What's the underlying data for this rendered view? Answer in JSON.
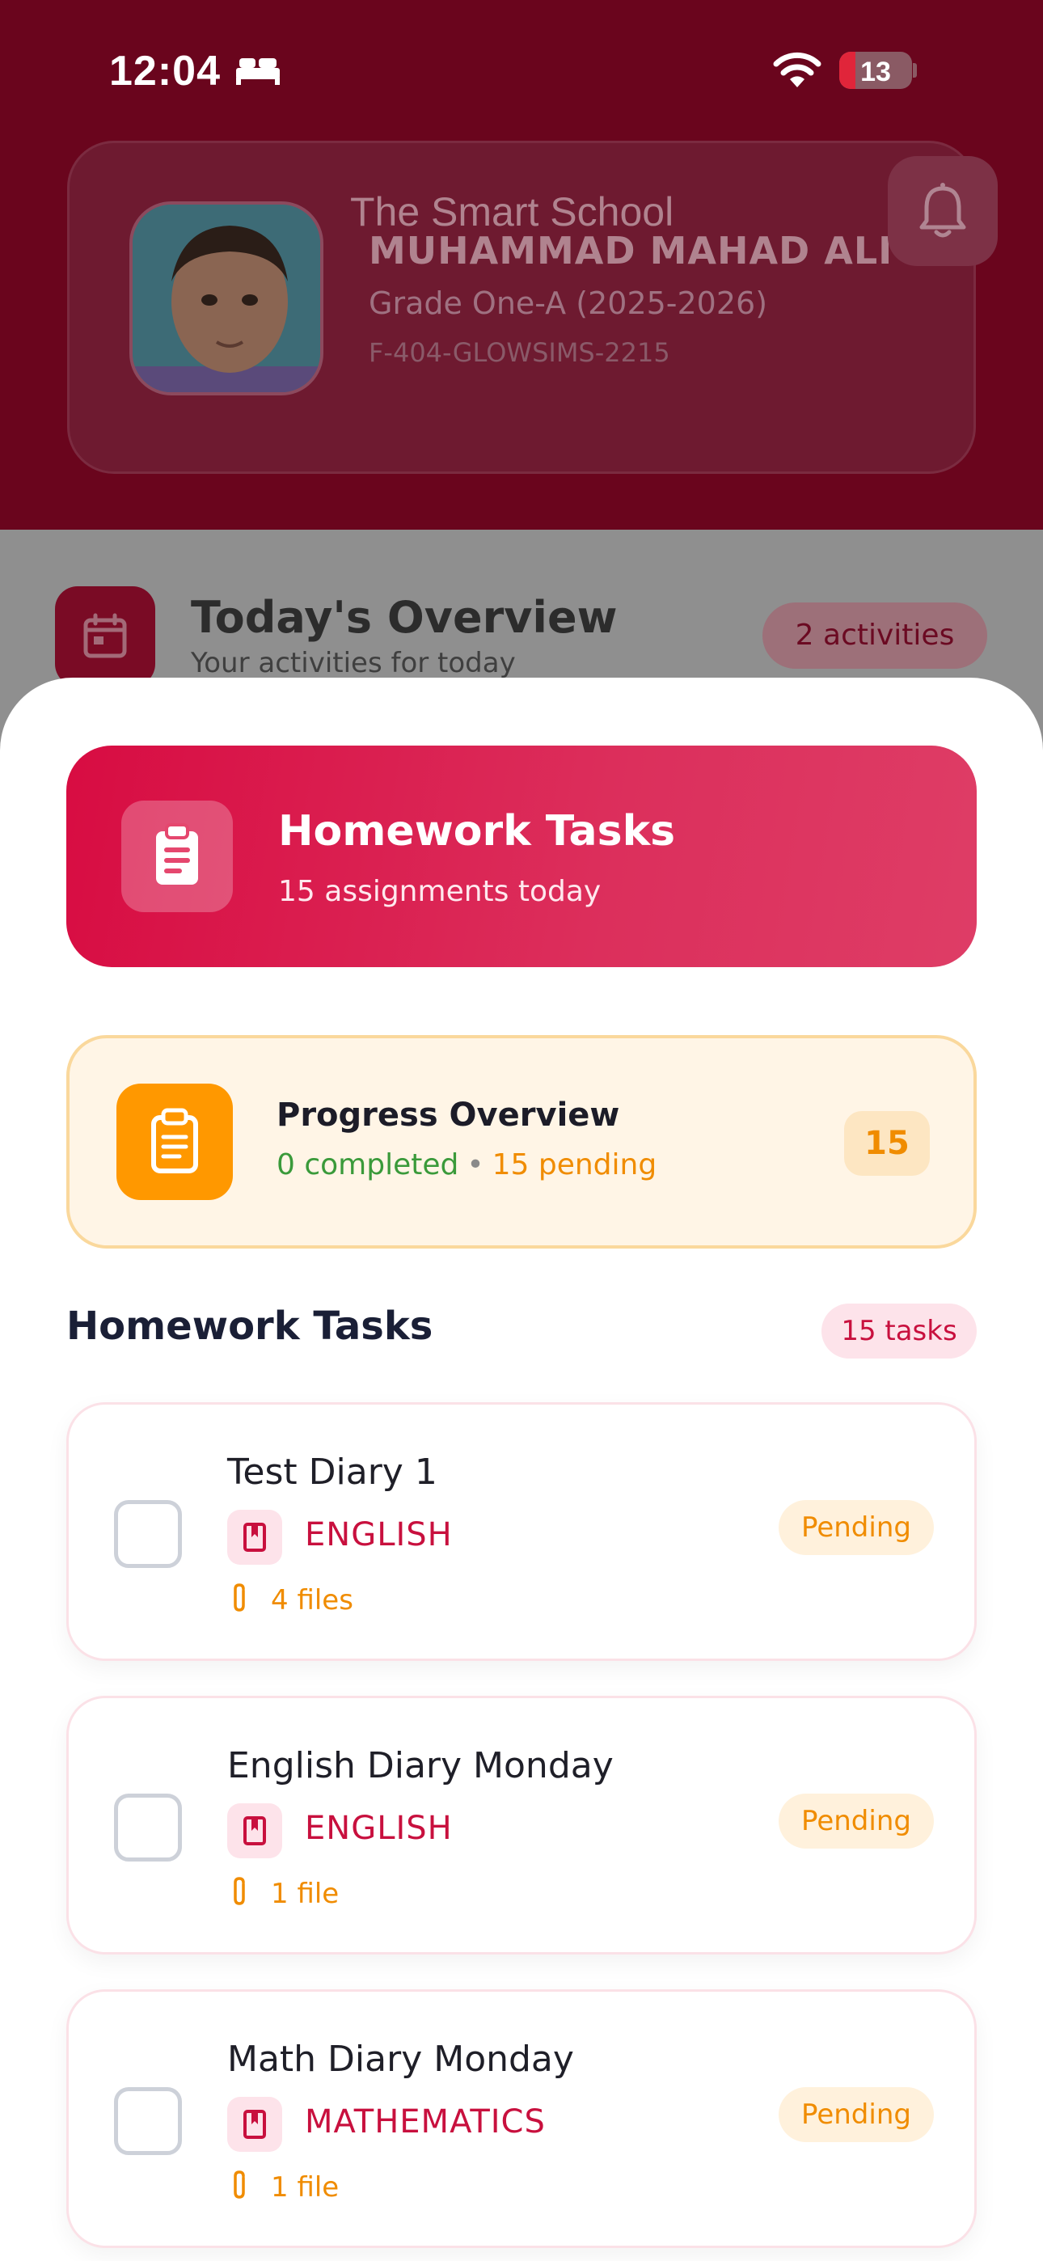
{
  "status_bar": {
    "time": "12:04",
    "battery": "13"
  },
  "profile": {
    "school": "The Smart School",
    "name": "MUHAMMAD MAHAD ALI",
    "grade": "Grade One-A (2025-2026)",
    "student_id": "F-404-GLOWSIMS-2215"
  },
  "overview": {
    "title": "Today's Overview",
    "subtitle": "Your activities for today",
    "activities": "2 activities"
  },
  "sheet": {
    "banner": {
      "title": "Homework Tasks",
      "subtitle": "15 assignments today"
    },
    "progress": {
      "title": "Progress Overview",
      "completed": "0 completed",
      "separator": "•",
      "pending": "15 pending",
      "count": "15"
    },
    "tasks_header": "Homework Tasks",
    "tasks_count": "15 tasks",
    "tasks": [
      {
        "title": "Test Diary 1",
        "subject": "ENGLISH",
        "files": "4 files",
        "status": "Pending"
      },
      {
        "title": "English Diary Monday",
        "subject": "ENGLISH",
        "files": "1 file",
        "status": "Pending"
      },
      {
        "title": "Math Diary Monday",
        "subject": "MATHEMATICS",
        "files": "1 file",
        "status": "Pending"
      }
    ]
  },
  "colors": {
    "brand": "#d80c42",
    "header_bg": "#6a051d",
    "pending": "#f08c00",
    "completed": "#3a9a3a"
  },
  "icons": [
    "bed-icon",
    "wifi-icon",
    "bell-icon",
    "calendar-icon",
    "clipboard-icon",
    "book-icon",
    "paperclip-icon",
    "checkbox-icon"
  ]
}
